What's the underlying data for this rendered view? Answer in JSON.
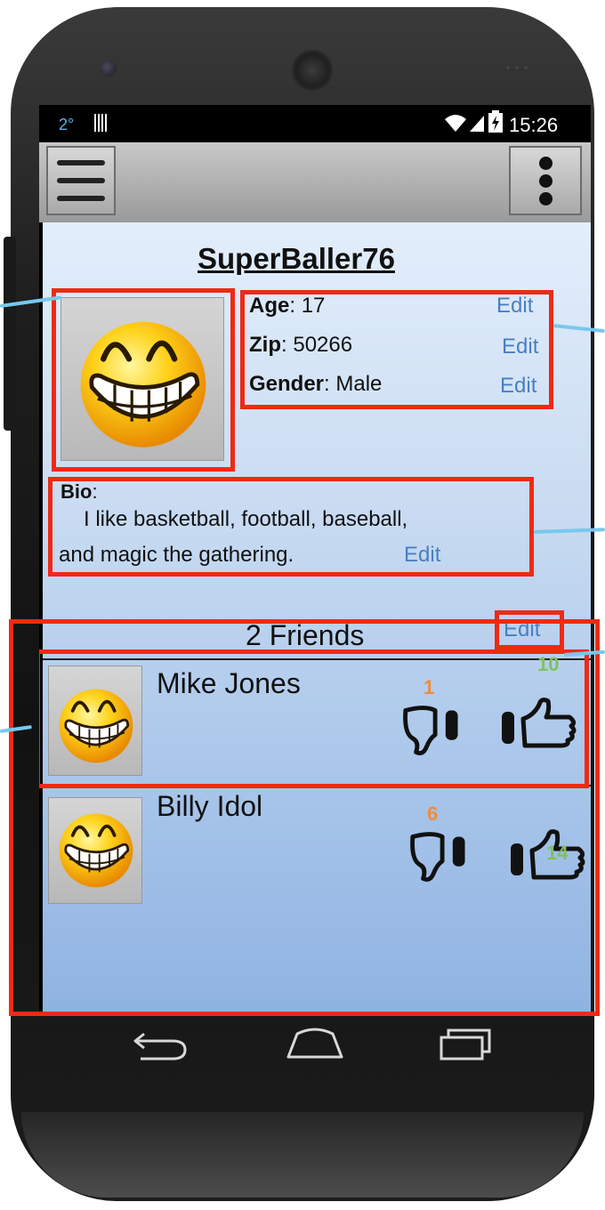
{
  "status_bar": {
    "left_indicator": "2°",
    "time": "15:26"
  },
  "profile": {
    "username": "SuperBaller76",
    "age_label": "Age",
    "age_value": "17",
    "zip_label": "Zip",
    "zip_value": "50266",
    "gender_label": "Gender",
    "gender_value": "Male",
    "edit_label": "Edit",
    "bio_label": "Bio",
    "bio_line1": "I like basketball, football, baseball,",
    "bio_line2": "and magic the gathering."
  },
  "friends": {
    "header": "2 Friends",
    "edit_label": "Edit",
    "list": [
      {
        "name": "Mike Jones",
        "dislikes": "1",
        "likes": "10"
      },
      {
        "name": "Billy Idol",
        "dislikes": "6",
        "likes": "14"
      }
    ]
  },
  "icons": [
    "menu-icon",
    "overflow-menu-icon",
    "wifi-icon",
    "signal-icon",
    "battery-icon",
    "smiley-avatar-icon",
    "thumbs-down-icon",
    "thumbs-up-icon",
    "back-icon",
    "home-icon",
    "recents-icon"
  ],
  "colors": {
    "annotation_red": "#ee2a14",
    "edit_blue": "#4a7fc0",
    "dislike_orange": "#f08c3c",
    "like_green": "#7fc25a",
    "callout_blue": "#77c8ee"
  }
}
